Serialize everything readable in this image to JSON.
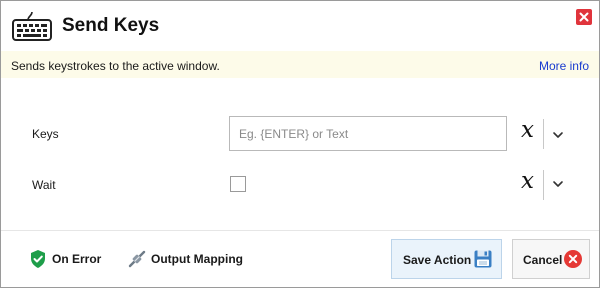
{
  "dialog": {
    "title": "Send Keys",
    "title_icon": "keyboard-icon",
    "close_icon": "close-icon"
  },
  "info": {
    "description": "Sends keystrokes to the active window.",
    "more_info": "More info"
  },
  "fields": {
    "keys": {
      "label": "Keys",
      "value": "",
      "placeholder": "Eg. {ENTER} or Text",
      "variable_icon": "variable-x-icon"
    },
    "wait": {
      "label": "Wait",
      "checked": false,
      "variable_icon": "variable-x-icon"
    }
  },
  "footer": {
    "on_error": "On Error",
    "on_error_icon": "shield-check-icon",
    "output_mapping": "Output Mapping",
    "output_mapping_icon": "mapping-icon",
    "save": "Save Action",
    "save_icon": "floppy-disk-icon",
    "cancel": "Cancel",
    "cancel_icon": "cancel-circle-icon"
  },
  "colors": {
    "info_bar": "#fdfbe9",
    "link": "#1a3ccf",
    "close": "#e0343c",
    "save_bg": "#eaf3fb",
    "shield": "#1e9e4a",
    "cancel": "#e53935"
  }
}
